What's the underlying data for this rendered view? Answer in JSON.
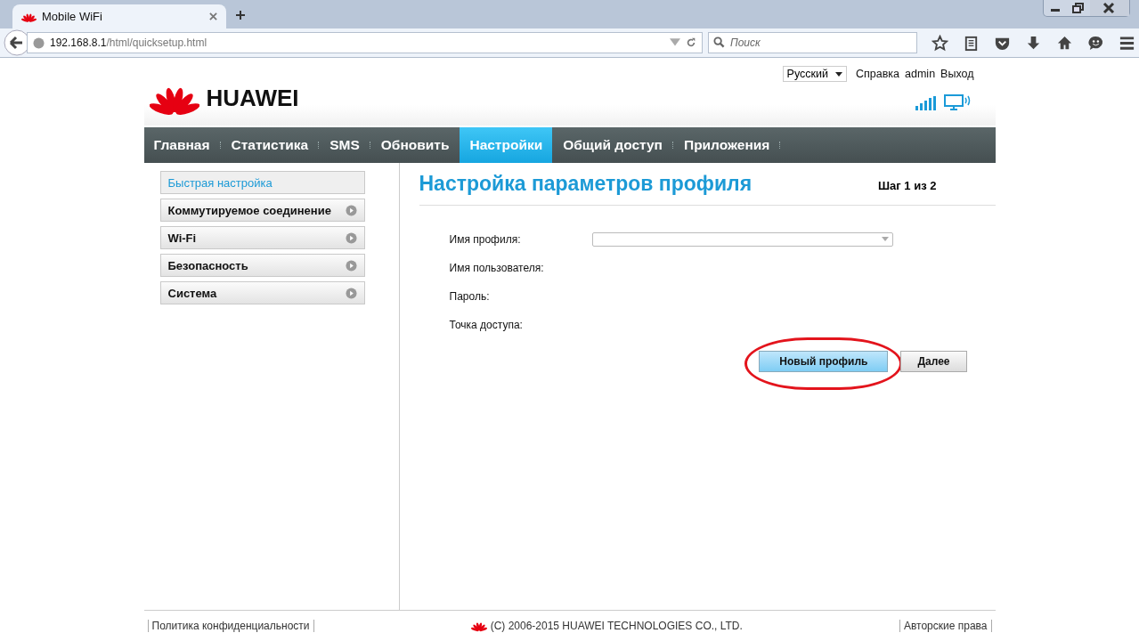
{
  "browser": {
    "tab": {
      "title": "Mobile WiFi",
      "selected": true
    },
    "address": {
      "host": "192.168.8.1",
      "path": "/html/quicksetup.html"
    },
    "search": {
      "placeholder": "Поиск"
    }
  },
  "header": {
    "brand": "HUAWEI",
    "language": "Русский",
    "links": [
      "Справка",
      "admin",
      "Выход"
    ]
  },
  "nav": [
    {
      "label": "Главная",
      "selected": false
    },
    {
      "label": "Статистика",
      "selected": false
    },
    {
      "label": "SMS",
      "selected": false
    },
    {
      "label": "Обновить",
      "selected": false
    },
    {
      "label": "Настройки",
      "selected": true
    },
    {
      "label": "Общий доступ",
      "selected": false
    },
    {
      "label": "Приложения",
      "selected": false
    }
  ],
  "sidebar": {
    "items": [
      {
        "label": "Быстрая настройка",
        "selected": true
      },
      {
        "label": "Коммутируемое соединение",
        "selected": false
      },
      {
        "label": "Wi-Fi",
        "selected": false
      },
      {
        "label": "Безопасность",
        "selected": false
      },
      {
        "label": "Система",
        "selected": false
      }
    ]
  },
  "page": {
    "title": "Настройка параметров профиля",
    "step": "Шаг 1 из 2",
    "fields": [
      {
        "label": "Имя профиля:",
        "kind": "select"
      },
      {
        "label": "Имя пользователя:",
        "kind": "text"
      },
      {
        "label": "Пароль:",
        "kind": "text"
      },
      {
        "label": "Точка доступа:",
        "kind": "text"
      }
    ],
    "buttons": [
      {
        "label": "Новый профиль",
        "kind": "primary",
        "annotated": true
      },
      {
        "label": "Далее",
        "kind": "default",
        "annotated": false
      }
    ]
  },
  "footer": {
    "left": "Политика конфиденциальности",
    "copyright": "(C) 2006-2015 HUAWEI TECHNOLOGIES CO., LTD.",
    "right": "Авторские права"
  }
}
